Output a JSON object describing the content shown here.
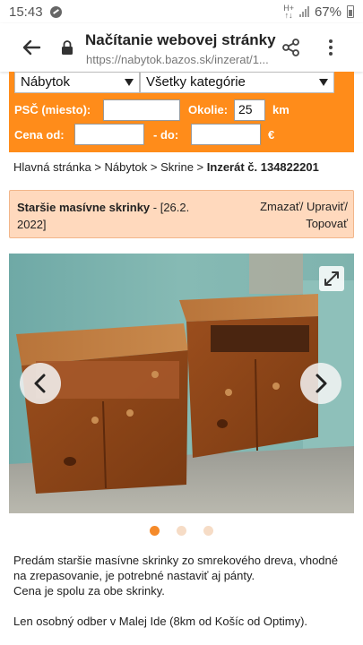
{
  "status_bar": {
    "time": "15:43",
    "net_top": "H+",
    "net_bottom": "↑↓",
    "battery": "67%"
  },
  "browser": {
    "title": "Načítanie webovej stránky",
    "url": "https://nabytok.bazos.sk/inzerat/1..."
  },
  "filter": {
    "category_select": "Nábytok",
    "subcategory_select": "Všetky kategórie",
    "psc_label": "PSČ  (miesto):",
    "psc_value": "",
    "okolie_label": "Okolie:",
    "okolie_value": "25",
    "km_label": "km",
    "price_from_label": "Cena  od:",
    "price_from_value": "",
    "price_to_label": "-  do:",
    "price_to_value": "",
    "currency": "€"
  },
  "breadcrumb": {
    "home": "Hlavná stránka",
    "sep": " > ",
    "category": "Nábytok",
    "subcategory": "Skrine",
    "current": "Inzerát č. 134822201"
  },
  "listing": {
    "title": "Staršie masívne skrinky",
    "date_part1": " - [26.2.",
    "date_part2": "2022]",
    "action_delete": "Zmazať/",
    "action_edit": "Upraviť/",
    "action_top": "Topovať"
  },
  "gallery": {
    "photo_count": 3,
    "active_index": 0
  },
  "description": {
    "line1": "Predám staršie masívne skrinky zo smrekového dreva, vhodné",
    "line2": "na zrepasovanie, je potrebné nastaviť aj pánty.",
    "line3": "Cena je spolu za obe skrinky.",
    "line4": "Len osobný odber v Malej Ide (8km od Košíc od Optimy)."
  },
  "colors": {
    "accent_orange": "#ff8c1a",
    "listing_header_bg": "#ffd9bd",
    "dot_active": "#f58a2a",
    "dot_inactive": "#f6dcc6"
  }
}
